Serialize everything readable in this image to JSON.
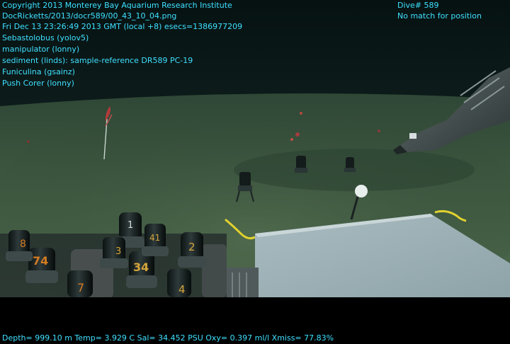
{
  "overlay": {
    "header_lines": [
      "Copyright 2013 Monterey Bay Aquarium Research Institute",
      "DocRicketts/2013/docr589/00_43_10_04.png",
      "Fri Dec 13 23:26:49 2013 GMT (local +8)  esecs=1386977209",
      "Sebastolobus (yolov5)",
      "manipulator (lonny)",
      "sediment (linds): sample-reference DR589 PC-19",
      "Funiculina (gsainz)",
      "Push Corer (lonny)"
    ],
    "dive": "Dive# 589",
    "position_status": "No match for position",
    "telemetry": "Depth= 999.10 m  Temp= 3.929 C  Sal= 34.452 PSU  Oxy= 0.397 ml/l  Xmiss= 77.83%",
    "text_color": "#3fe0ff"
  },
  "scene": {
    "tube_labels": [
      "74",
      "1",
      "2",
      "34",
      "4",
      "7",
      "8",
      "41",
      "3"
    ],
    "water_color": "#0c1a1a",
    "seafloor_color": "#3f5a41",
    "platform_color": "#9eb3b8"
  }
}
